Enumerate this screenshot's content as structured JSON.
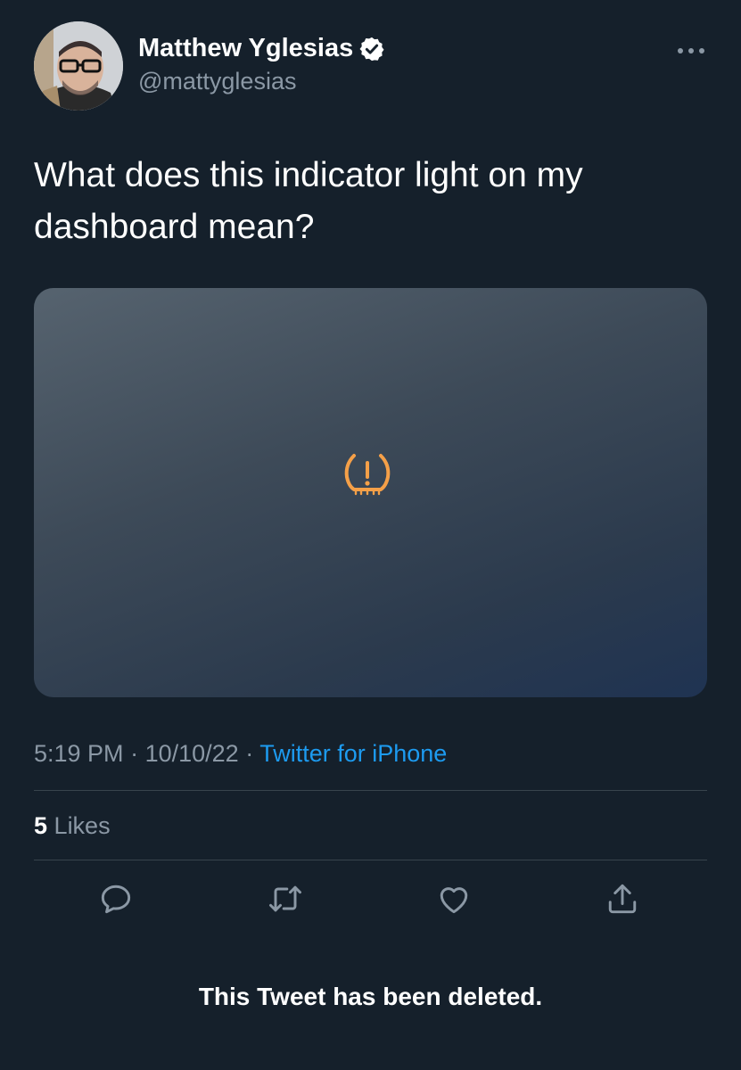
{
  "author": {
    "display_name": "Matthew Yglesias",
    "handle": "@mattyglesias",
    "verified_icon": "verified-badge-icon"
  },
  "tweet": {
    "text": "What does this indicator light on my dashboard mean?",
    "media_icon": "tire-pressure-warning-icon",
    "time": "5:19 PM",
    "separator": "·",
    "date": "10/10/22",
    "source": "Twitter for iPhone"
  },
  "stats": {
    "likes_count": "5",
    "likes_label": "Likes"
  },
  "actions": {
    "icons": [
      "reply-icon",
      "retweet-icon",
      "like-icon",
      "share-icon"
    ]
  },
  "notice": "This Tweet has been deleted.",
  "colors": {
    "background": "#15202b",
    "text": "#ffffff",
    "secondary_text": "#8b98a5",
    "link": "#1d9bf0",
    "divider": "#38444d",
    "warning_light": "#f5a048"
  }
}
